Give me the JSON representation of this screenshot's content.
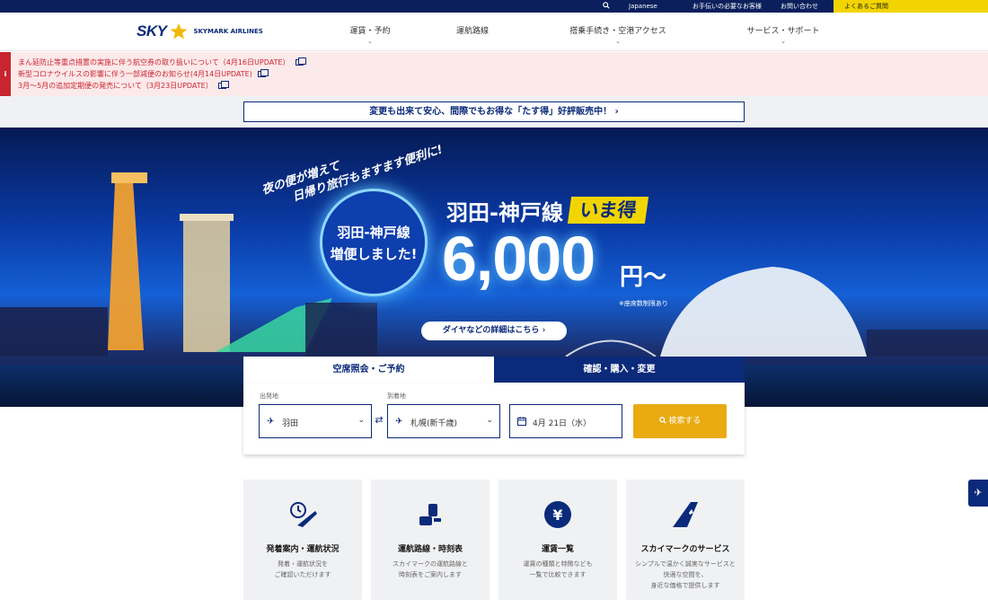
{
  "utility": {
    "language": "Japanese",
    "help": "お手伝いの必要なお客様",
    "contact": "お問い合わせ",
    "faq": "よくあるご質問"
  },
  "header": {
    "logo_text": "SKY",
    "brand_name": "SKYMARK AIRLINES",
    "nav": [
      "運賃・予約",
      "運航路線",
      "搭乗手続き・空港アクセス",
      "サービス・サポート"
    ]
  },
  "alerts": [
    "まん延防止等重点措置の実施に伴う航空券の取り扱いについて（4月16日UPDATE）",
    "新型コロナウイルスの影響に伴う一部減便のお知らせ(4月14日UPDATE)",
    "3月～5月の追加定期便の発売について（3月23日UPDATE）"
  ],
  "promo_bar": "変更も出来て安心、間際でもお得な「たす得」好評販売中！ ›",
  "hero": {
    "tagline_1": "夜の便が増えて",
    "tagline_2": "日帰り旅行もますます便利に!",
    "circle_line_1": "羽田-神戸線",
    "circle_line_2": "増便しました!",
    "route": "羽田-神戸線",
    "badge": "いま得",
    "price": "6,000",
    "price_unit": "円～",
    "seat_note": "※座席数制限あり",
    "detail_button": "ダイヤなどの詳細はこちら ›"
  },
  "search": {
    "tab_reserve": "空席照会・ご予約",
    "tab_confirm": "確認・購入・変更",
    "origin_label": "出発地",
    "origin_value": "羽田",
    "destination_label": "到着地",
    "destination_value": "札幌(新千歳)",
    "date_value": "4月 21日（水）",
    "search_button": "検索する"
  },
  "cards": [
    {
      "title": "発着案内・運航状況",
      "desc": "発着・運航状況を\nご確認いただけます"
    },
    {
      "title": "運航路線・時刻表",
      "desc": "スカイマークの運航路線と\n時刻表をご案内します"
    },
    {
      "title": "運賃一覧",
      "desc": "運賃の種類と特徴なども\n一覧で比較できます"
    },
    {
      "title": "スカイマークのサービス",
      "desc": "シンプルで温かく誠実なサービスと\n快適な空間を、\n身近な価格で提供します"
    }
  ],
  "colors": {
    "navy": "#0b2a7a",
    "yellow": "#f2d500",
    "alert_red": "#c9252f",
    "search_orange": "#e9aa12"
  }
}
